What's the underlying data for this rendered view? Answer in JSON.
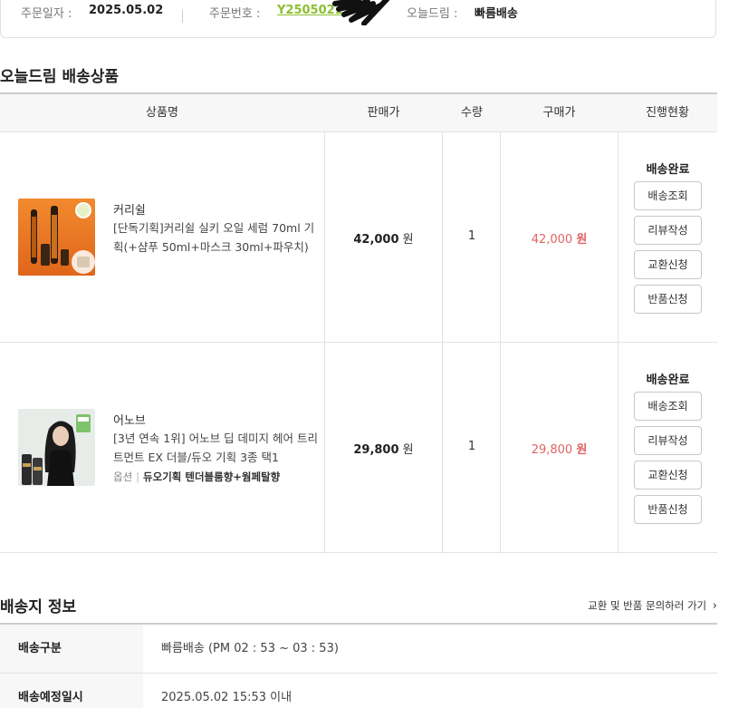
{
  "order_info": {
    "date_label": "주문일자 :",
    "date_value": "2025.05.02",
    "number_label": "주문번호 :",
    "number_value": "Y2505021",
    "type_label": "오늘드림 :",
    "type_value": "빠름배송"
  },
  "products_section": {
    "title": "오늘드림 배송상품",
    "columns": [
      "상품명",
      "판매가",
      "수량",
      "구매가",
      "진행현황"
    ],
    "items": [
      {
        "brand": "커리쉴",
        "name": "[단독기획]커리쉴 실키 오일 세럼 70ml 기획(+샴푸 50ml+마스크 30ml+파우치)",
        "option_label": "",
        "option_value": "",
        "price": "42,000",
        "price_unit": "원",
        "qty": "1",
        "purchase_price": "42,000",
        "purchase_unit": "원",
        "status": "배송완료",
        "buttons": [
          "배송조회",
          "리뷰작성",
          "교환신청",
          "반품신청"
        ]
      },
      {
        "brand": "어노브",
        "name": "[3년 연속 1위] 어노브 딥 데미지 헤어 트리트먼트 EX 더블/듀오 기획 3종 택1",
        "option_label": "옵션",
        "option_value": "듀오기획 텐더블룸향+웜페탈향",
        "price": "29,800",
        "price_unit": "원",
        "qty": "1",
        "purchase_price": "29,800",
        "purchase_unit": "원",
        "status": "배송완료",
        "buttons": [
          "배송조회",
          "리뷰작성",
          "교환신청",
          "반품신청"
        ]
      }
    ]
  },
  "shipping_section": {
    "title": "배송지 정보",
    "link": "교환 및 반품 문의하러 가기",
    "rows": [
      {
        "label": "배송구분",
        "value": "빠름배송 (PM 02 : 53 ~ 03 : 53)"
      },
      {
        "label": "배송예정일시",
        "value": "2025.05.02 15:53 이내"
      }
    ]
  },
  "colors": {
    "order_number": "#8dbf2f",
    "purchase_price": "#e06363",
    "header_bg": "#f7f7f7",
    "border": "#e3e3e3"
  }
}
